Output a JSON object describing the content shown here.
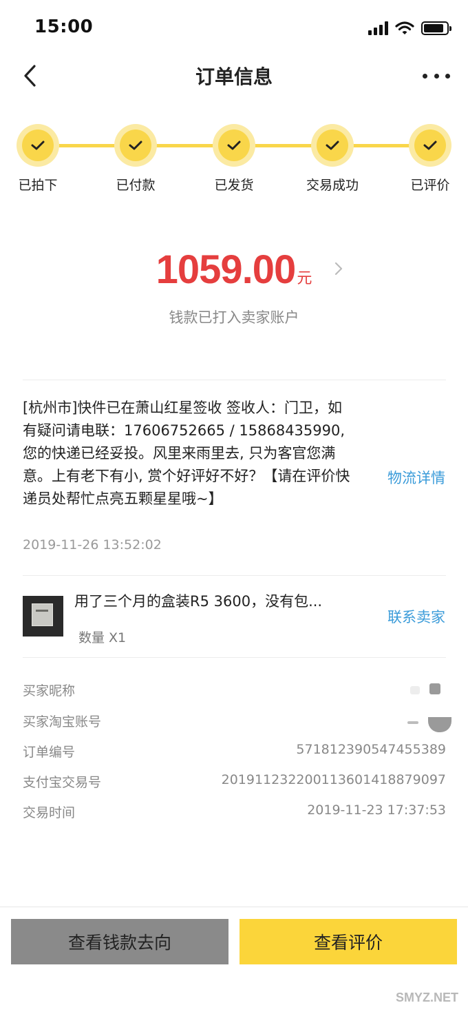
{
  "status_bar": {
    "time": "15:00"
  },
  "nav": {
    "title": "订单信息"
  },
  "steps": [
    {
      "label": "已拍下"
    },
    {
      "label": "已付款"
    },
    {
      "label": "已发货"
    },
    {
      "label": "交易成功"
    },
    {
      "label": "已评价"
    }
  ],
  "payment": {
    "amount": "1059.00",
    "currency": "元",
    "note": "钱款已打入卖家账户"
  },
  "logistics": {
    "message": "[杭州市]快件已在萧山红星签收 签收人：门卫，如有疑问请电联：17606752665 / 15868435990, 您的快递已经妥投。风里来雨里去, 只为客官您满意。上有老下有小, 赏个好评好不好？【请在评价快递员处帮忙点亮五颗星星哦~】",
    "time": "2019-11-26 13:52:02",
    "detail_link": "物流详情"
  },
  "product": {
    "title": "用了三个月的盒装R5 3600，没有包...",
    "quantity": "数量 X1",
    "contact_link": "联系卖家"
  },
  "order_info": {
    "buyer_nick_label": "买家昵称",
    "buyer_taobao_label": "买家淘宝账号",
    "order_no_label": "订单编号",
    "order_no": "571812390547455389",
    "alipay_no_label": "支付宝交易号",
    "alipay_no": "2019112322001136014188790​97",
    "trade_time_label": "交易时间",
    "trade_time": "2019-11-23 17:37:53"
  },
  "actions": {
    "view_money_flow": "查看钱款去向",
    "view_review": "查看评价"
  },
  "watermark": "SMYZ.NET",
  "colors": {
    "accent_yellow": "#f9d64a",
    "amount_red": "#e53e3e",
    "link_blue": "#3a9bd9"
  }
}
